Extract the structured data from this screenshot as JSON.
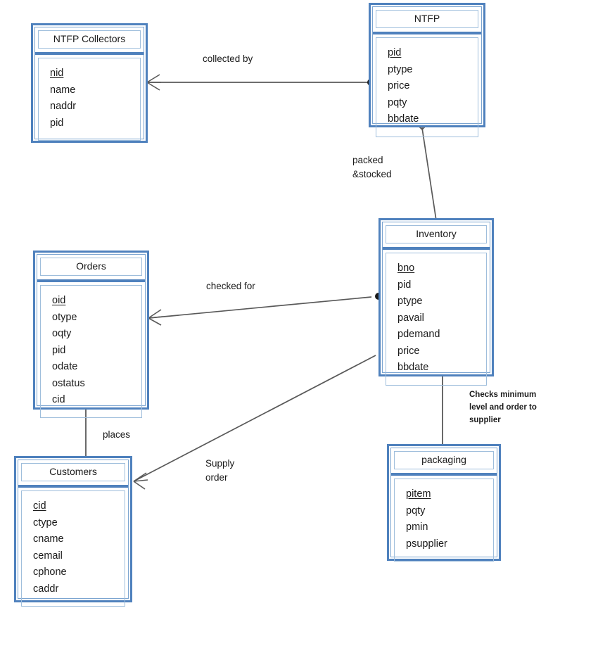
{
  "diagram": {
    "type": "entity-relationship-diagram",
    "notation": "crow's foot",
    "accent_color": "#4F81BD",
    "background_color": "#FFFFFF",
    "text_color": "#1A1A1A"
  },
  "entities": [
    {
      "id": "ntfp-collectors",
      "title": "NTFP Collectors",
      "attributes": [
        {
          "name": "nid",
          "pk": true
        },
        {
          "name": "name",
          "pk": false
        },
        {
          "name": "naddr",
          "pk": false
        },
        {
          "name": "pid",
          "pk": false
        }
      ]
    },
    {
      "id": "ntfp",
      "title": "NTFP",
      "attributes": [
        {
          "name": "pid",
          "pk": true
        },
        {
          "name": "ptype",
          "pk": false
        },
        {
          "name": "price",
          "pk": false
        },
        {
          "name": "pqty",
          "pk": false
        },
        {
          "name": "bbdate",
          "pk": false
        }
      ]
    },
    {
      "id": "inventory",
      "title": "Inventory",
      "attributes": [
        {
          "name": "bno",
          "pk": true
        },
        {
          "name": "pid",
          "pk": false
        },
        {
          "name": "ptype",
          "pk": false
        },
        {
          "name": "pavail",
          "pk": false
        },
        {
          "name": "pdemand",
          "pk": false
        },
        {
          "name": "price",
          "pk": false
        },
        {
          "name": "bbdate",
          "pk": false
        }
      ]
    },
    {
      "id": "orders",
      "title": "Orders",
      "attributes": [
        {
          "name": "oid",
          "pk": true
        },
        {
          "name": "otype",
          "pk": false
        },
        {
          "name": "oqty",
          "pk": false
        },
        {
          "name": "pid",
          "pk": false
        },
        {
          "name": "odate",
          "pk": false
        },
        {
          "name": "ostatus",
          "pk": false
        },
        {
          "name": "cid",
          "pk": false
        }
      ]
    },
    {
      "id": "customers",
      "title": "Customers",
      "attributes": [
        {
          "name": "cid",
          "pk": true
        },
        {
          "name": "ctype",
          "pk": false
        },
        {
          "name": "cname",
          "pk": false
        },
        {
          "name": "cemail",
          "pk": false
        },
        {
          "name": "cphone",
          "pk": false
        },
        {
          "name": "caddr",
          "pk": false
        }
      ]
    },
    {
      "id": "packaging",
      "title": "packaging",
      "attributes": [
        {
          "name": "pitem",
          "pk": true
        },
        {
          "name": "pqty",
          "pk": false
        },
        {
          "name": "pmin",
          "pk": false
        },
        {
          "name": "psupplier",
          "pk": false
        }
      ]
    }
  ],
  "relationships": [
    {
      "id": "collected-by",
      "label": "collected by",
      "from": "ntfp-collectors",
      "to": "ntfp",
      "from_end": "crows-foot",
      "to_end": "filled-dot"
    },
    {
      "id": "packed-stocked",
      "label": "packed\n&stocked",
      "from": "ntfp",
      "to": "inventory",
      "from_end": "crows-foot",
      "to_end": "plain"
    },
    {
      "id": "checked-for",
      "label": "checked for",
      "from": "orders",
      "to": "inventory",
      "from_end": "crows-foot",
      "to_end": "filled-dot"
    },
    {
      "id": "places",
      "label": "places",
      "from": "orders",
      "to": "customers",
      "from_end": "crows-foot",
      "to_end": "plain"
    },
    {
      "id": "supply-order",
      "label": "Supply\norder",
      "from": "customers",
      "to": "inventory",
      "from_end": "crows-foot",
      "to_end": "plain"
    },
    {
      "id": "checks-minimum",
      "label": "Checks minimum\nlevel and order to\nsupplier",
      "from": "inventory",
      "to": "packaging",
      "from_end": "plain",
      "to_end": "crows-foot"
    }
  ]
}
